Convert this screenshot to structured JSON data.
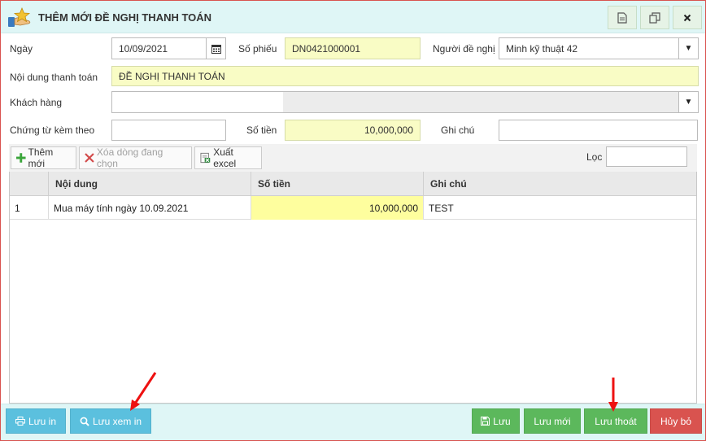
{
  "dialog": {
    "title": "THÊM MỚI ĐỀ NGHỊ THANH TOÁN",
    "header_buttons": [
      "document-icon",
      "copy-icon",
      "close-icon"
    ]
  },
  "form": {
    "ngay_label": "Ngày",
    "ngay_value": "10/09/2021",
    "so_phieu_label": "Số phiếu",
    "so_phieu_value": "DN0421000001",
    "nguoi_de_nghi_label": "Người đề nghị",
    "nguoi_de_nghi_value": "Minh kỹ thuật 42",
    "noi_dung_label": "Nội dung thanh toán",
    "noi_dung_value": "ĐỀ NGHỊ THANH TOÁN",
    "khach_hang_label": "Khách hàng",
    "khach_hang_value": "",
    "chung_tu_label": "Chứng từ kèm theo",
    "chung_tu_value": "",
    "so_tien_label": "Số tiền",
    "so_tien_value": "10,000,000",
    "ghi_chu_label": "Ghi chú",
    "ghi_chu_value": ""
  },
  "toolbar": {
    "add_label": "Thêm mới",
    "delete_label": "Xóa dòng đang chọn",
    "export_label": "Xuất excel",
    "filter_label": "Lọc"
  },
  "grid": {
    "columns": [
      "",
      "Nội dung",
      "Số tiền",
      "Ghi chú"
    ],
    "rows": [
      {
        "stt": "1",
        "noi_dung": "Mua máy tính ngày 10.09.2021",
        "so_tien": "10,000,000",
        "ghi_chu": "TEST"
      }
    ]
  },
  "footer": {
    "luu_in": "Lưu in",
    "luu_xem_in": "Lưu xem in",
    "luu": "Lưu",
    "luu_moi": "Lưu mới",
    "luu_thoat": "Lưu thoát",
    "huy_bo": "Hủy bỏ"
  },
  "colors": {
    "header_bg": "#dff6f6",
    "yellow_input": "#f9fcc5",
    "green_button": "#5cb85c",
    "blue_button": "#5bc0de",
    "red_button": "#d9534f",
    "annotation_arrow": "#ee1111"
  }
}
